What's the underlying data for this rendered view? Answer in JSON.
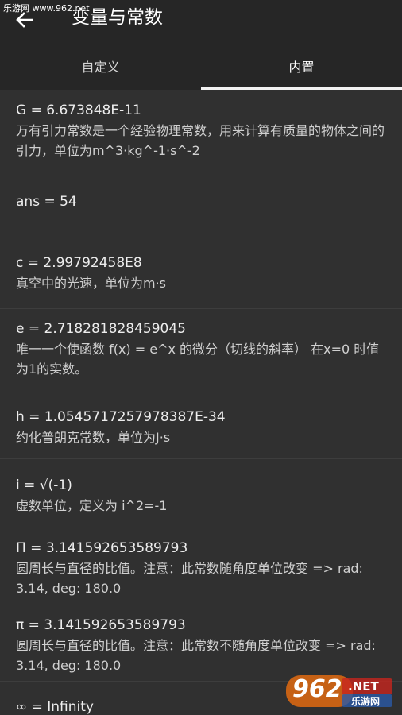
{
  "watermark": {
    "top_text": "乐游网 www.962.net",
    "logo_number": "962",
    "logo_suffix": ".NET",
    "logo_caption": "乐游网"
  },
  "header": {
    "title": "变量与常数",
    "back_icon": "arrow-left-icon"
  },
  "tabs": [
    {
      "label": "自定义",
      "active": false
    },
    {
      "label": "内置",
      "active": true
    }
  ],
  "constants": [
    {
      "name": "G = 6.673848E-11",
      "desc": "万有引力常数是一个经验物理常数，用来计算有质量的物体之间的引力，单位为m^3·kg^-1·s^-2"
    },
    {
      "name": "ans = 54",
      "desc": ""
    },
    {
      "name": "c = 2.99792458E8",
      "desc": "真空中的光速，单位为m·s"
    },
    {
      "name": "e = 2.718281828459045",
      "desc": "唯一一个使函数 f(x) = e^x 的微分（切线的斜率） 在x=0 时值为1的实数。"
    },
    {
      "name": "h = 1.0545717257978387E-34",
      "desc": "约化普朗克常数，单位为J·s"
    },
    {
      "name": "i = √(-1)",
      "desc": "虚数单位，定义为 i^2=-1"
    },
    {
      "name": "Π = 3.141592653589793",
      "desc": "圆周长与直径的比值。注意：此常数随角度单位改变 => rad: 3.14, deg: 180.0"
    },
    {
      "name": "π = 3.141592653589793",
      "desc": "圆周长与直径的比值。注意：此常数不随角度单位改变 => rad: 3.14, deg: 180.0"
    },
    {
      "name": "∞ = Infinity",
      "desc": ""
    }
  ]
}
